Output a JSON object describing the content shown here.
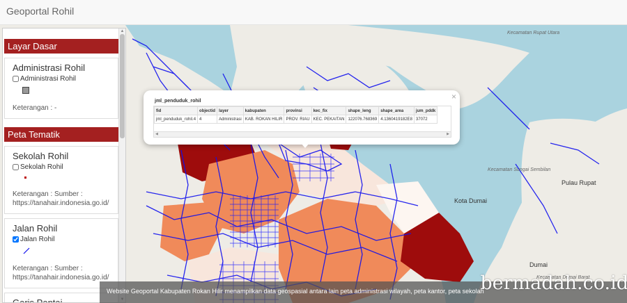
{
  "app": {
    "title": "Geoportal Rohil"
  },
  "sidebar": {
    "sections": [
      {
        "title": "Layar Dasar"
      },
      {
        "title": "Peta Tematik"
      }
    ],
    "layers": [
      {
        "title": "Administrasi Rohil",
        "checkbox_label": "Administrasi Rohil",
        "checked": false,
        "note": "Keterangan : -"
      },
      {
        "title": "Sekolah Rohil",
        "checkbox_label": "Sekolah Rohil",
        "checked": false,
        "note": "Keterangan : Sumber : https://tanahair.indonesia.go.id/"
      },
      {
        "title": "Jalan Rohil",
        "checkbox_label": "Jalan Rohil",
        "checked": true,
        "note": "Keterangan : Sumber : https://tanahair.indonesia.go.id/"
      },
      {
        "title": "Garis Pantai"
      }
    ]
  },
  "popup": {
    "title": "jml_penduduk_rohil",
    "close": "×",
    "columns": [
      "fid",
      "objectid",
      "layer",
      "kabupaten",
      "provinsi",
      "kec_fix",
      "shape_leng",
      "shape_area",
      "jum_pddk"
    ],
    "rows": [
      [
        "jml_penduduk_rohil.4",
        "4",
        "Administrasi",
        "KAB. ROKAN HILIR",
        "PROV. RIAU",
        "KEC. PEKAITAN",
        "122076.768369",
        "4.1360419182E8",
        "37072"
      ]
    ]
  },
  "map": {
    "labels": {
      "rupat_utara": "Kecamatan Rupat Utara",
      "pulau_rupat": "Pulau Rupat",
      "sungai_sembilan": "Kecamatan Sungai Sembilan",
      "kota_dumai": "Kota Dumai",
      "dumai": "Dumai",
      "dumai_barat": "Kecamatan Dumai Barat"
    },
    "colors": {
      "sea": "#aad3df",
      "land": "#eeece6",
      "road": "#1010ee",
      "dark_red": "#9e0c0c",
      "orange": "#f08a5a",
      "light": "#f8e6dc"
    }
  },
  "footer": {
    "text": "Website Geoportal Kabupaten Rokan Hilir menampilkan data geospasial antara lain peta administrasi wilayah, peta kantor, peta sekolah"
  },
  "watermark": "bermadah.co.id"
}
